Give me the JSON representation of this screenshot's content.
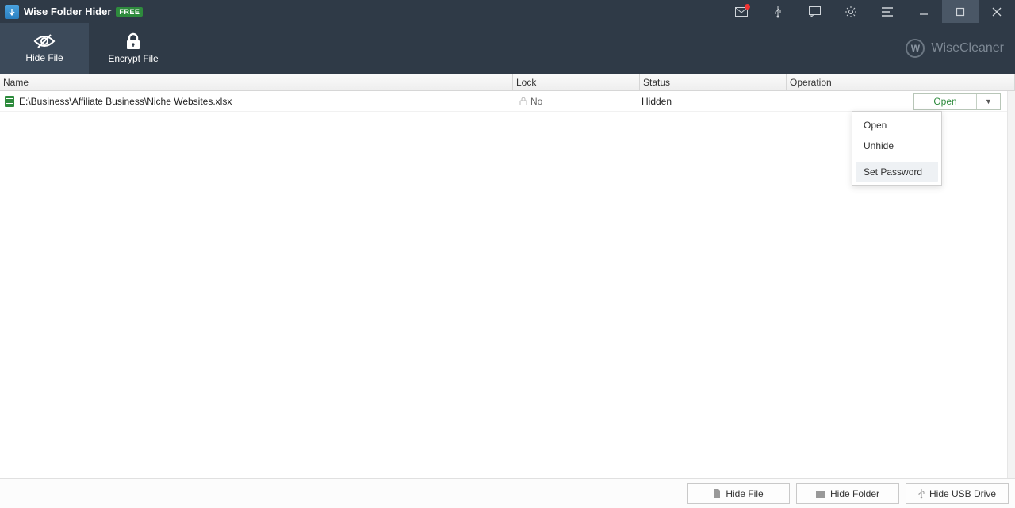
{
  "app": {
    "title": "Wise Folder Hider",
    "badge": "FREE"
  },
  "brand": "WiseCleaner",
  "tabs": {
    "hide_file": "Hide File",
    "encrypt_file": "Encrypt File"
  },
  "columns": {
    "name": "Name",
    "lock": "Lock",
    "status": "Status",
    "operation": "Operation"
  },
  "rows": [
    {
      "name": "E:\\Business\\Affiliate Business\\Niche Websites.xlsx",
      "lock": "No",
      "status": "Hidden",
      "operation_label": "Open"
    }
  ],
  "dropdown": {
    "open": "Open",
    "unhide": "Unhide",
    "set_password": "Set Password"
  },
  "footer": {
    "hide_file": "Hide File",
    "hide_folder": "Hide Folder",
    "hide_usb": "Hide USB Drive"
  }
}
